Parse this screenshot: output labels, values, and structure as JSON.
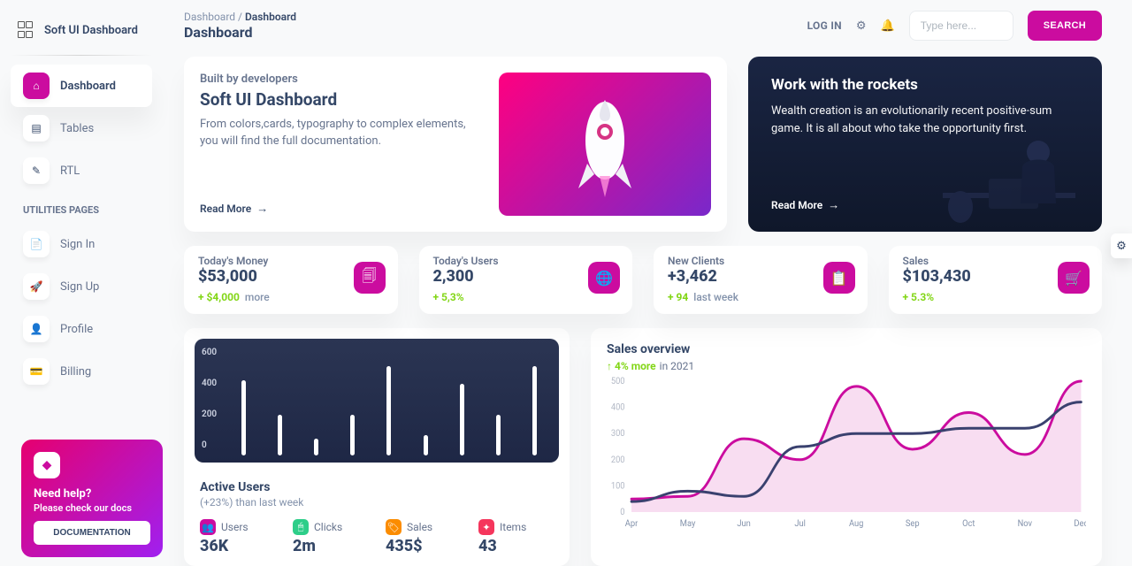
{
  "brand": "Soft UI Dashboard",
  "nav": {
    "section1": [
      {
        "label": "Dashboard",
        "glyph": "⌂",
        "active": true
      },
      {
        "label": "Tables",
        "glyph": "▤",
        "active": false
      },
      {
        "label": "RTL",
        "glyph": "✎",
        "active": false
      }
    ],
    "section_label": "Utilities Pages",
    "section2": [
      {
        "label": "Sign In",
        "glyph": "📄"
      },
      {
        "label": "Sign Up",
        "glyph": "🚀"
      },
      {
        "label": "Profile",
        "glyph": "👤"
      },
      {
        "label": "Billing",
        "glyph": "💳"
      }
    ]
  },
  "help": {
    "title": "Need help?",
    "subtitle": "Please check our docs",
    "button": "DOCUMENTATION"
  },
  "breadcrumb": {
    "root": "Dashboard",
    "sep": " / ",
    "current": "Dashboard"
  },
  "page_title": "Dashboard",
  "topbar": {
    "login": "LOG IN",
    "search_placeholder": "Type here...",
    "search_button": "SEARCH"
  },
  "hero1": {
    "overline": "Built by developers",
    "title": "Soft UI Dashboard",
    "body": "From colors,cards, typography to complex elements, you will find the full documentation.",
    "cta": "Read More"
  },
  "hero2": {
    "title": "Work with the rockets",
    "body": "Wealth creation is an evolutionarily recent positive-sum game. It is all about who take the opportunity first.",
    "cta": "Read More"
  },
  "stats": [
    {
      "label": "Today's Money",
      "value": "$53,000",
      "delta": "+ $4,000",
      "delta_suffix": "more",
      "glyph": "🗐"
    },
    {
      "label": "Today's Users",
      "value": "2,300",
      "delta": "+ 5,3%",
      "delta_suffix": "",
      "glyph": "🌐"
    },
    {
      "label": "New Clients",
      "value": "+3,462",
      "delta": "+ 94",
      "delta_suffix": "last week",
      "glyph": "📋"
    },
    {
      "label": "Sales",
      "value": "$103,430",
      "delta": "+ 5.3%",
      "delta_suffix": "",
      "glyph": "🛒"
    }
  ],
  "active_users": {
    "title": "Active Users",
    "subtitle": "(+23%) than last week",
    "items": [
      {
        "label": "Users",
        "value": "36K",
        "color": "#cb0c9f",
        "glyph": "👥"
      },
      {
        "label": "Clicks",
        "value": "2m",
        "color": "#2dce89",
        "glyph": "🖱"
      },
      {
        "label": "Sales",
        "value": "435$",
        "color": "#fb8c00",
        "glyph": "🏷"
      },
      {
        "label": "Items",
        "value": "43",
        "color": "#f5365c",
        "glyph": "✦"
      }
    ]
  },
  "sales_overview": {
    "title": "Sales overview",
    "delta": "↑ 4% more",
    "suffix": "in 2021"
  },
  "chart_data": {
    "bar": {
      "type": "bar",
      "y_ticks": [
        600,
        400,
        200,
        0
      ],
      "values": [
        440,
        240,
        100,
        240,
        520,
        120,
        420,
        240,
        520
      ]
    },
    "lines": {
      "type": "line",
      "y_ticks": [
        500,
        400,
        300,
        200,
        100,
        0
      ],
      "categories": [
        "Apr",
        "May",
        "Jun",
        "Jul",
        "Aug",
        "Sep",
        "Oct",
        "Nov",
        "Dec"
      ],
      "series": [
        {
          "name": "pink",
          "color": "#cb0c9f",
          "values": [
            50,
            60,
            280,
            200,
            480,
            240,
            380,
            220,
            500
          ]
        },
        {
          "name": "navy",
          "color": "#3a416f",
          "values": [
            40,
            80,
            60,
            250,
            300,
            300,
            320,
            320,
            420
          ]
        }
      ]
    }
  },
  "colors": {
    "primary": "#cb0c9f"
  }
}
